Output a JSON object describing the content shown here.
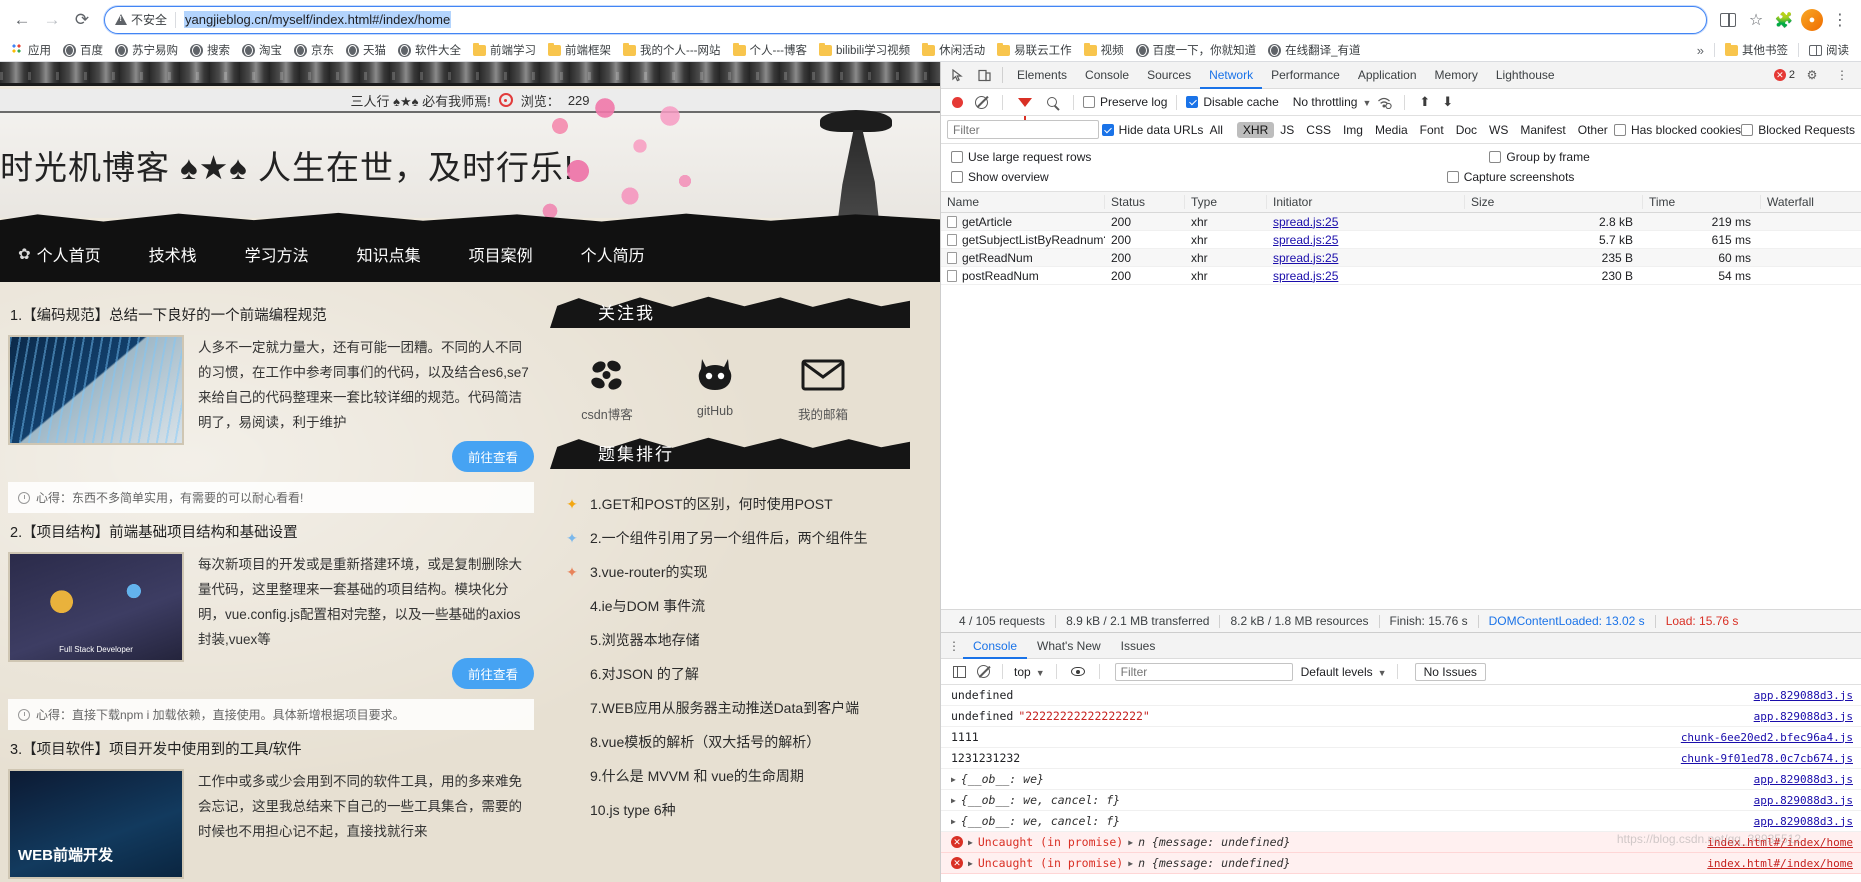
{
  "browser": {
    "back_label": "←",
    "forward_label": "→",
    "reload_label": "⟳",
    "security_label": "不安全",
    "url": "yangjieblog.cn/myself/index.html#/index/home",
    "qr_icon": "qr-code-icon",
    "star_icon": "bookmark-star-icon",
    "extensions_icon": "extensions-puzzle-icon",
    "profile_icon": "profile-avatar-icon",
    "menu_icon": "three-dot-menu-icon",
    "bookmarks": [
      {
        "label": "应用",
        "icon": "apps-grid-icon"
      },
      {
        "label": "百度",
        "icon": "globe-icon"
      },
      {
        "label": "苏宁易购",
        "icon": "globe-icon"
      },
      {
        "label": "搜索",
        "icon": "globe-icon"
      },
      {
        "label": "淘宝",
        "icon": "globe-icon"
      },
      {
        "label": "京东",
        "icon": "globe-icon"
      },
      {
        "label": "天猫",
        "icon": "globe-icon"
      },
      {
        "label": "软件大全",
        "icon": "globe-icon"
      },
      {
        "label": "前端学习",
        "icon": "folder-icon"
      },
      {
        "label": "前端框架",
        "icon": "folder-icon"
      },
      {
        "label": "我的个人---网站",
        "icon": "folder-icon"
      },
      {
        "label": "个人---博客",
        "icon": "folder-icon"
      },
      {
        "label": "bilibili学习视频",
        "icon": "folder-icon"
      },
      {
        "label": "休闲活动",
        "icon": "folder-icon"
      },
      {
        "label": "易联云工作",
        "icon": "folder-icon"
      },
      {
        "label": "视频",
        "icon": "folder-icon"
      },
      {
        "label": "百度一下，你就知道",
        "icon": "globe-icon"
      },
      {
        "label": "在线翻译_有道",
        "icon": "globe-icon"
      }
    ],
    "overflow_label": "»",
    "other_bookmarks": {
      "label": "其他书签",
      "icon": "folder-icon"
    },
    "reading_list": {
      "label": "阅读",
      "icon": "reading-list-icon"
    }
  },
  "site": {
    "top_bar": {
      "slogan": "三人行 ♠★♠ 必有我师焉!",
      "views_label": "浏览：",
      "views_count": "229"
    },
    "hero_title": "时光机博客 ♠★♠ 人生在世，及时行乐!",
    "nav": [
      "个人首页",
      "技术栈",
      "学习方法",
      "知识点集",
      "项目案例",
      "个人简历"
    ],
    "articles": [
      {
        "title": "1.【编码规范】总结一下良好的一个前端编程规范",
        "desc": "人多不一定就力量大，还有可能一团糟。不同的人不同的习惯，在工作中参考同事们的代码，以及结合es6,se7来给自己的代码整理来一套比较详细的规范。代码简洁明了，易阅读，利于维护",
        "button": "前往查看",
        "note": "心得：东西不多简单实用，有需要的可以耐心看看!"
      },
      {
        "title": "2.【项目结构】前端基础项目结构和基础设置",
        "desc": "每次新项目的开发或是重新搭建环境，或是复制删除大量代码，这里整理来一套基础的项目结构。模块化分明，vue.config.js配置相对完整，以及一些基础的axios封装,vuex等",
        "button": "前往查看",
        "note": "心得：直接下载npm i 加载依赖，直接使用。具体新增根据项目要求。"
      },
      {
        "title": "3.【项目软件】项目开发中使用到的工具/软件",
        "desc": "工作中或多或少会用到不同的软件工具，用的多来难免会忘记，这里我总结来下自己的一些工具集合，需要的时候也不用担心记不起，直接找就行来",
        "button": "前往查看",
        "note": ""
      }
    ],
    "follow": {
      "title": "关注我",
      "links": [
        {
          "name": "csdn博客",
          "icon": "csdn-logo-icon"
        },
        {
          "name": "gitHub",
          "icon": "github-logo-icon"
        },
        {
          "name": "我的邮箱",
          "icon": "email-envelope-icon"
        }
      ]
    },
    "rank": {
      "title": "题集排行",
      "items": [
        {
          "medal": "gold",
          "text": "1.GET和POST的区别，何时使用POST"
        },
        {
          "medal": "silver",
          "text": "2.一个组件引用了另一个组件后，两个组件生"
        },
        {
          "medal": "bronze",
          "text": "3.vue-router的实现"
        },
        {
          "medal": "none",
          "text": "4.ie与DOM 事件流"
        },
        {
          "medal": "none",
          "text": "5.浏览器本地存储"
        },
        {
          "medal": "none",
          "text": "6.对JSON 的了解"
        },
        {
          "medal": "none",
          "text": "7.WEB应用从服务器主动推送Data到客户端"
        },
        {
          "medal": "none",
          "text": "8.vue模板的解析（双大括号的解析）"
        },
        {
          "medal": "none",
          "text": "9.什么是 MVVM 和 vue的生命周期"
        },
        {
          "medal": "none",
          "text": "10.js type 6种"
        }
      ]
    }
  },
  "devtools": {
    "inspect_icon": "inspect-element-icon",
    "device_icon": "device-toolbar-icon",
    "tabs": [
      {
        "label": "Elements",
        "active": false
      },
      {
        "label": "Console",
        "active": false
      },
      {
        "label": "Sources",
        "active": false
      },
      {
        "label": "Network",
        "active": true
      },
      {
        "label": "Performance",
        "active": false
      },
      {
        "label": "Application",
        "active": false
      },
      {
        "label": "Memory",
        "active": false
      },
      {
        "label": "Lighthouse",
        "active": false
      }
    ],
    "error_count": "2",
    "settings_icon": "gear-icon",
    "more_icon": "three-dot-menu-icon",
    "toolbar": {
      "record_icon": "record-stop-icon",
      "clear_icon": "clear-network-icon",
      "filter_icon": "filter-funnel-icon",
      "search_icon": "search-icon",
      "preserve_log": "Preserve log",
      "preserve_log_checked": false,
      "disable_cache": "Disable cache",
      "disable_cache_checked": true,
      "throttling": "No throttling",
      "wifi_icon": "network-conditions-icon",
      "import_icon": "import-har-icon",
      "export_icon": "export-har-icon"
    },
    "filterbar": {
      "filter_placeholder": "Filter",
      "hide_data_urls": "Hide data URLs",
      "hide_data_urls_checked": true,
      "types": [
        "All",
        "XHR",
        "JS",
        "CSS",
        "Img",
        "Media",
        "Font",
        "Doc",
        "WS",
        "Manifest",
        "Other"
      ],
      "active_type": "XHR",
      "has_blocked_cookies": "Has blocked cookies",
      "has_blocked_cookies_checked": false,
      "blocked_requests": "Blocked Requests",
      "blocked_requests_checked": false
    },
    "options": {
      "use_large_request_rows": "Use large request rows",
      "use_large_request_rows_checked": false,
      "group_by_frame": "Group by frame",
      "group_by_frame_checked": false,
      "show_overview": "Show overview",
      "show_overview_checked": false,
      "capture_screenshots": "Capture screenshots",
      "capture_screenshots_checked": false
    },
    "table": {
      "columns": [
        "Name",
        "Status",
        "Type",
        "Initiator",
        "Size",
        "Time",
        "Waterfall"
      ],
      "rows": [
        {
          "name": "getArticle",
          "status": "200",
          "type": "xhr",
          "initiator": "spread.js:25",
          "size": "2.8 kB",
          "time": "219 ms"
        },
        {
          "name": "getSubjectListByReadnum?pa…",
          "status": "200",
          "type": "xhr",
          "initiator": "spread.js:25",
          "size": "5.7 kB",
          "time": "615 ms"
        },
        {
          "name": "getReadNum",
          "status": "200",
          "type": "xhr",
          "initiator": "spread.js:25",
          "size": "235 B",
          "time": "60 ms"
        },
        {
          "name": "postReadNum",
          "status": "200",
          "type": "xhr",
          "initiator": "spread.js:25",
          "size": "230 B",
          "time": "54 ms"
        }
      ]
    },
    "summary": {
      "requests": "4 / 105 requests",
      "transferred": "8.9 kB / 2.1 MB transferred",
      "resources": "8.2 kB / 1.8 MB resources",
      "finish": "Finish: 15.76 s",
      "dom_content_loaded": "DOMContentLoaded: 13.02 s",
      "load": "Load: 15.76 s"
    },
    "drawer": {
      "tabs": [
        {
          "label": "Console",
          "active": true
        },
        {
          "label": "What's New",
          "active": false
        },
        {
          "label": "Issues",
          "active": false
        }
      ],
      "sidebar_icon": "console-sidebar-icon",
      "clear_icon": "clear-console-icon",
      "context": "top",
      "eye_icon": "live-expression-icon",
      "filter_placeholder": "Filter",
      "levels": "Default levels",
      "issues_button": "No Issues",
      "messages": [
        {
          "type": "log",
          "text": "undefined",
          "extra": "",
          "source": "app.829088d3.js"
        },
        {
          "type": "log",
          "text": "undefined",
          "extra": "\"22222222222222222\"",
          "source": "app.829088d3.js"
        },
        {
          "type": "log",
          "text": "1111",
          "extra": "",
          "source": "chunk-6ee20ed2.bfec96a4.js"
        },
        {
          "type": "log",
          "text": "1231231232",
          "extra": "",
          "source": "chunk-9f01ed78.0c7cb674.js"
        },
        {
          "type": "object",
          "text": "{__ob__: we}",
          "extra": "",
          "source": "app.829088d3.js"
        },
        {
          "type": "object",
          "text": "{__ob__: we, cancel: f}",
          "extra": "",
          "source": "app.829088d3.js"
        },
        {
          "type": "object",
          "text": "{__ob__: we, cancel: f}",
          "extra": "",
          "source": "app.829088d3.js"
        },
        {
          "type": "error",
          "text": "Uncaught (in promise)",
          "extra": "n {message: undefined}",
          "source": "index.html#/index/home"
        },
        {
          "type": "error",
          "text": "Uncaught (in promise)",
          "extra": "n {message: undefined}",
          "source": "index.html#/index/home"
        }
      ],
      "watermark": "https://blog.csdn.net/qq_38935512"
    }
  }
}
